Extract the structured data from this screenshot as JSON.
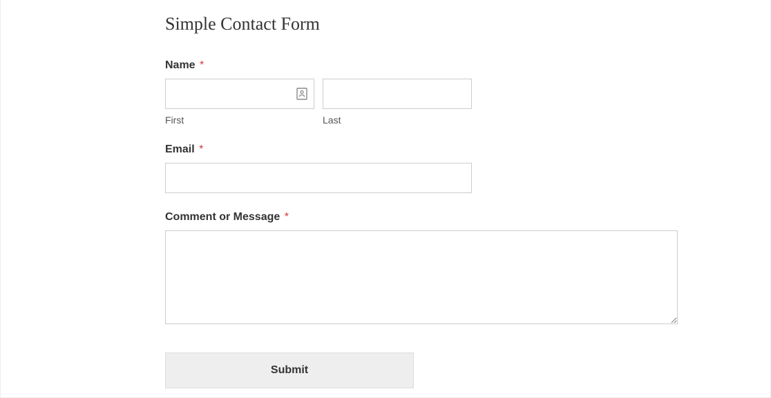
{
  "form": {
    "title": "Simple Contact Form",
    "fields": {
      "name": {
        "label": "Name",
        "required_mark": "*",
        "first_sublabel": "First",
        "last_sublabel": "Last",
        "first_value": "",
        "last_value": ""
      },
      "email": {
        "label": "Email",
        "required_mark": "*",
        "value": ""
      },
      "message": {
        "label": "Comment or Message",
        "required_mark": "*",
        "value": ""
      }
    },
    "submit_label": "Submit"
  }
}
